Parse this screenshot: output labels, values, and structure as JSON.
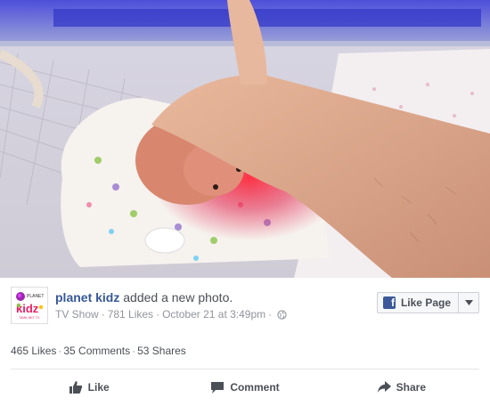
{
  "post": {
    "page_name": "planet kidz",
    "action_text": " added a new photo.",
    "category": "TV Show",
    "likes": "781 Likes",
    "date": "October 21 at 3:49pm",
    "separator": "·"
  },
  "logo": {
    "icon": "planet-kidz-logo",
    "text_top": "PLANET",
    "text_main": "kidz",
    "text_bottom": "TAMIL NET TV"
  },
  "like_page_button": {
    "label": "Like Page",
    "icon": "facebook-f-icon"
  },
  "stats": {
    "likes": "465 Likes",
    "comments": "35 Comments",
    "shares": "53 Shares"
  },
  "actions": {
    "like": "Like",
    "comment": "Comment",
    "share": "Share"
  },
  "colors": {
    "link": "#365899",
    "text": "#4b4f56",
    "meta": "#90949c",
    "facebook_blue": "#3b5998"
  }
}
